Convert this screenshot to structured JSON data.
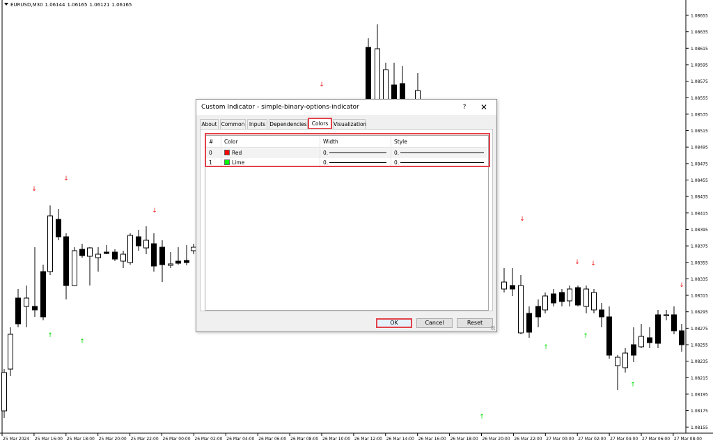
{
  "chart": {
    "symbol": "EURUSD,M30",
    "ohlc": [
      "1.06144",
      "1.06165",
      "1.06121",
      "1.06165"
    ],
    "price_labels": [
      "1.08655",
      "1.08635",
      "1.08615",
      "1.08595",
      "1.08575",
      "1.08555",
      "1.08535",
      "1.08515",
      "1.08495",
      "1.08475",
      "1.08455",
      "1.08435",
      "1.08415",
      "1.08395",
      "1.08375",
      "1.08355",
      "1.08335",
      "1.08315",
      "1.08295",
      "1.08275",
      "1.08255",
      "1.08235",
      "1.08215",
      "1.08195",
      "1.08175",
      "1.08155"
    ],
    "time_labels": [
      "25 Mar 2024",
      "25 Mar 16:00",
      "25 Mar 18:00",
      "25 Mar 20:00",
      "25 Mar 22:00",
      "26 Mar 00:00",
      "26 Mar 02:00",
      "26 Mar 04:00",
      "26 Mar 06:00",
      "26 Mar 08:00",
      "26 Mar 10:00",
      "26 Mar 12:00",
      "26 Mar 14:00",
      "26 Mar 16:00",
      "26 Mar 18:00",
      "26 Mar 20:00",
      "26 Mar 22:00",
      "27 Mar 00:00",
      "27 Mar 02:00",
      "27 Mar 04:00",
      "27 Mar 06:00",
      "27 Mar 08:00"
    ],
    "colors": {
      "bull": "#ffffff",
      "bear": "#000000",
      "up_arrow": "#00dd00",
      "down_arrow": "#ee1111"
    }
  },
  "dialog": {
    "title": "Custom Indicator - simple-binary-options-indicator",
    "help_label": "?",
    "close_label": "✕",
    "tabs": [
      {
        "label": "About"
      },
      {
        "label": "Common"
      },
      {
        "label": "Inputs"
      },
      {
        "label": "Dependencies"
      },
      {
        "label": "Colors",
        "active": true
      },
      {
        "label": "Visualization"
      }
    ],
    "table": {
      "columns": [
        "#",
        "Color",
        "Width",
        "Style"
      ],
      "rows": [
        {
          "index": "0",
          "color_name": "Red",
          "color": "#ff0000",
          "width": "0.",
          "style": "0."
        },
        {
          "index": "1",
          "color_name": "Lime",
          "color": "#00ff00",
          "width": "0.",
          "style": "0."
        }
      ]
    },
    "buttons": {
      "ok": "OK",
      "cancel": "Cancel",
      "reset": "Reset"
    },
    "highlight_color": "#e3424a"
  }
}
